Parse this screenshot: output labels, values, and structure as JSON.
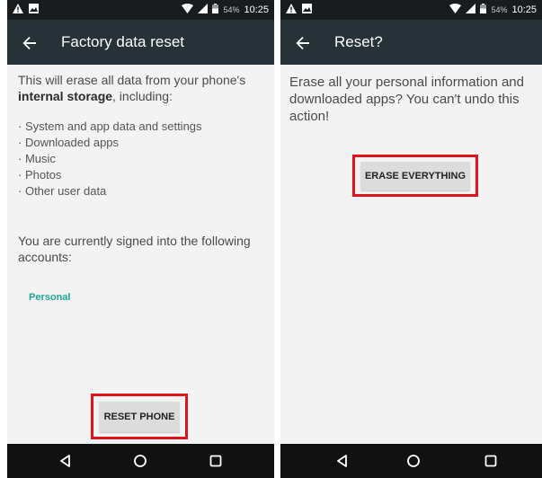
{
  "left": {
    "status": {
      "battery": "54%",
      "time": "10:25"
    },
    "appbar": {
      "title": "Factory data reset"
    },
    "intro_text": "This will erase all data from your phone's",
    "intro_bold": "internal storage",
    "intro_after": ", including:",
    "items": [
      "System and app data and settings",
      "Downloaded apps",
      "Music",
      "Photos",
      "Other user data"
    ],
    "signed_in_text": "You are currently signed into the following accounts:",
    "account": "Personal",
    "button_label": "RESET PHONE"
  },
  "right": {
    "status": {
      "battery": "54%",
      "time": "10:25"
    },
    "appbar": {
      "title": "Reset?"
    },
    "message": "Erase all your personal information and downloaded apps? You can't undo this action!",
    "button_label": "ERASE EVERYTHING"
  },
  "colors": {
    "highlight": "#e0121c",
    "account": "#1ea896",
    "appbar": "#263238",
    "statusbar": "#191c1e"
  },
  "icons": [
    "warning-icon",
    "image-icon",
    "wifi-icon",
    "signal-icon",
    "battery-icon",
    "back-arrow-icon",
    "nav-back-icon",
    "nav-home-icon",
    "nav-recents-icon"
  ]
}
